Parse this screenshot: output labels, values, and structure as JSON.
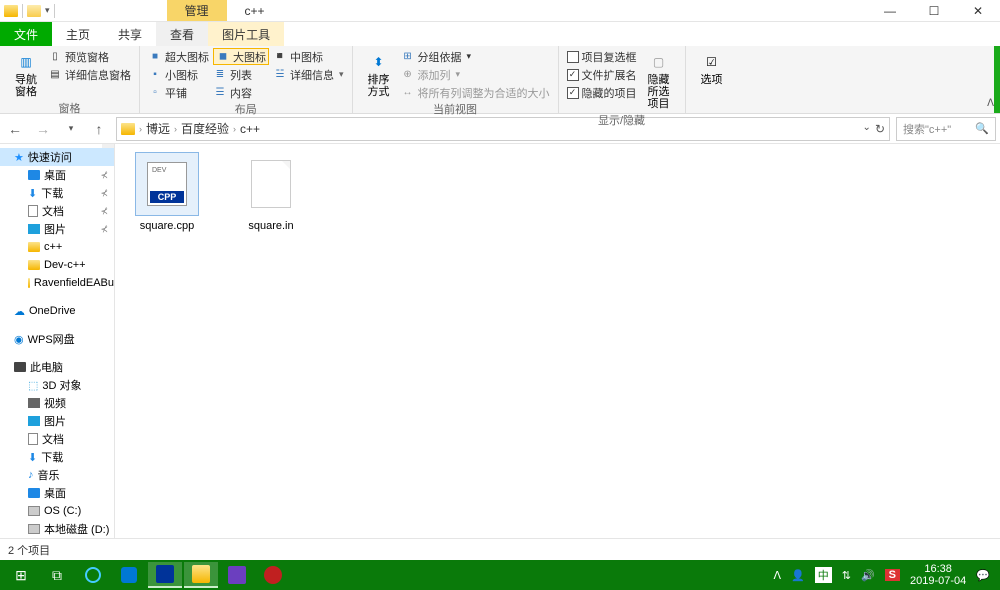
{
  "window": {
    "title": "c++",
    "context_tab": "管理"
  },
  "tabs": {
    "file": "文件",
    "home": "主页",
    "share": "共享",
    "view": "查看",
    "picture_tools": "图片工具"
  },
  "ribbon": {
    "panes_group": {
      "nav_pane": "导航窗格",
      "preview_pane": "预览窗格",
      "details_pane": "详细信息窗格",
      "label": "窗格"
    },
    "layout_group": {
      "extra_large": "超大图标",
      "large": "大图标",
      "medium": "中图标",
      "small": "小图标",
      "list": "列表",
      "details": "详细信息",
      "tiles": "平铺",
      "content": "内容",
      "label": "布局"
    },
    "current_view": {
      "sort": "排序方式",
      "group_by": "分组依据",
      "add_columns": "添加列",
      "size_columns": "将所有列调整为合适的大小",
      "label": "当前视图"
    },
    "show_hide": {
      "item_checkboxes": "项目复选框",
      "file_ext": "文件扩展名",
      "hidden_items": "隐藏的项目",
      "hide_selected": "隐藏所选项目",
      "label": "显示/隐藏"
    },
    "options": {
      "options": "选项"
    }
  },
  "breadcrumb": {
    "p1": "博远",
    "p2": "百度经验",
    "p3": "c++"
  },
  "search": {
    "placeholder": "搜索\"c++\""
  },
  "sidebar": {
    "quick_access": "快速访问",
    "desktop": "桌面",
    "downloads": "下载",
    "documents": "文档",
    "pictures": "图片",
    "cpp": "c++",
    "devcpp": "Dev-c++",
    "ravenfield": "RavenfieldEABu",
    "onedrive": "OneDrive",
    "wps": "WPS网盘",
    "this_pc": "此电脑",
    "objects_3d": "3D 对象",
    "videos": "视频",
    "pc_pictures": "图片",
    "pc_documents": "文档",
    "pc_downloads": "下载",
    "music": "音乐",
    "pc_desktop": "桌面",
    "os_c": "OS (C:)",
    "local_d": "本地磁盘 (D:)"
  },
  "files": {
    "f1": "square.cpp",
    "f2": "square.in"
  },
  "status": {
    "text": "2 个项目"
  },
  "taskbar": {
    "time": "16:38",
    "date": "2019-07-04",
    "ime_zh": "中",
    "ime_s": "S"
  }
}
